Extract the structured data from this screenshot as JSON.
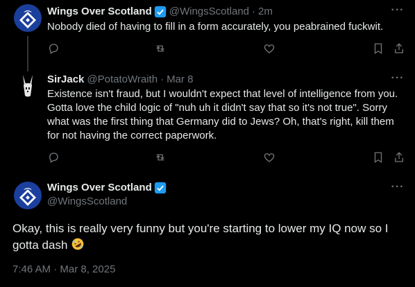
{
  "tweets": [
    {
      "name": "Wings Over Scotland",
      "handle": "@WingsScotland",
      "sep": "·",
      "time": "2m",
      "verified": true,
      "text": "Nobody died of having to fill in a form accurately, you peabrained fuckwit."
    },
    {
      "name": "SirJack",
      "handle": "@PotatoWraith",
      "sep": "·",
      "time": "Mar 8",
      "verified": false,
      "text": "Existence isn't fraud, but I wouldn't expect that level of intelligence from you. Gotta love the child logic of \"nuh uh it didn't say that so it's not true\". Sorry what was the first thing that Germany did to Jews? Oh, that's right, kill them for not having the correct paperwork."
    }
  ],
  "main_tweet": {
    "name": "Wings Over Scotland",
    "handle": "@WingsScotland",
    "verified": true,
    "text": "Okay, this is really very funny but you're starting to lower my IQ now so I gotta dash",
    "emoji": "rolling-on-floor-laughing",
    "timestamp": "7:46 AM · Mar 8, 2025"
  },
  "more_label": "···",
  "colors": {
    "background": "#000000",
    "text": "#e7e9ea",
    "muted": "#71767b",
    "verified": "#1d9bf0",
    "divider": "#2f3336"
  },
  "icons": {
    "reply": "reply-icon",
    "retweet": "retweet-icon",
    "like": "like-icon",
    "bookmark": "bookmark-icon",
    "share": "share-icon",
    "more": "more-icon"
  }
}
